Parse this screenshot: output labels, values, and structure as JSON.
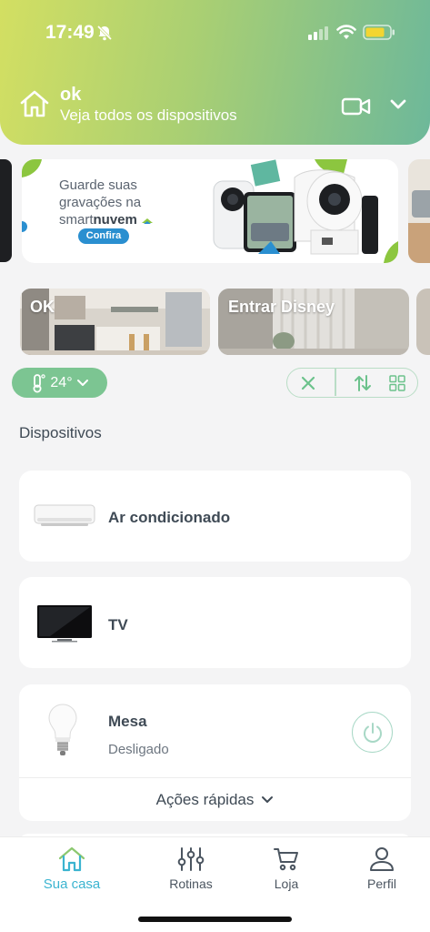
{
  "status_bar": {
    "time": "17:49"
  },
  "header": {
    "home_name": "ok",
    "subtitle": "Veja todos os dispositivos"
  },
  "banner": {
    "line1": "Guarde suas",
    "line2": "gravações na",
    "brand_prefix": "smart",
    "brand_bold": "nuvem",
    "button": "Confira"
  },
  "scenes": [
    {
      "label": "OK"
    },
    {
      "label": "Entrar Disney"
    }
  ],
  "filters": {
    "temperature": "24°"
  },
  "devices_title": "Dispositivos",
  "devices": [
    {
      "name": "Ar condicionado"
    },
    {
      "name": "TV"
    },
    {
      "name": "Mesa",
      "status": "Desligado",
      "quick_actions": "Ações rápidas"
    }
  ],
  "nav": [
    {
      "label": "Sua casa",
      "icon": "home-icon",
      "active": true
    },
    {
      "label": "Rotinas",
      "icon": "sliders-icon"
    },
    {
      "label": "Loja",
      "icon": "cart-icon"
    },
    {
      "label": "Perfil",
      "icon": "user-icon"
    }
  ],
  "colors": {
    "accent": "#3bb4d0",
    "green": "#7cc592",
    "header_start": "#d3df62",
    "header_end": "#6db89a"
  }
}
